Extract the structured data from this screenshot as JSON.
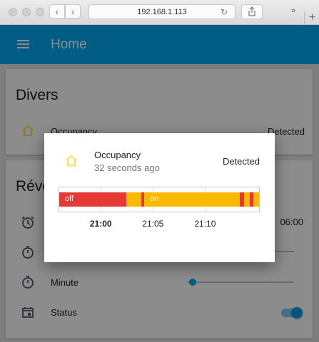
{
  "browser": {
    "address": "192.168.1.113",
    "back_glyph": "‹",
    "forward_glyph": "›",
    "reload_glyph": "↻",
    "more_glyph": "»",
    "newtab_glyph": "+"
  },
  "app": {
    "title": "Home",
    "accent": "#03a9f4"
  },
  "cards": {
    "divers": {
      "title": "Divers",
      "row_label": "Occupancy",
      "row_value": "Detected"
    },
    "reveil": {
      "title": "Réveil",
      "time_value": "06:00",
      "minute_label": "Minute",
      "status_label": "Status",
      "minute_level": 0.05,
      "status_on": true
    }
  },
  "dialog": {
    "entity_name": "Occupancy",
    "relative_time": "32 seconds ago",
    "state": "Detected",
    "icon": "home-icon",
    "icon_color": "#fdd835"
  },
  "chart_data": {
    "type": "timeline",
    "x_ticks": [
      "21:00",
      "21:05",
      "21:10"
    ],
    "colors": {
      "off": "#e53935",
      "on": "#fbb800",
      "marker": "#7e57c2"
    },
    "segments": [
      {
        "state": "off",
        "start": 0.0,
        "end": 0.335,
        "label": "off"
      },
      {
        "state": "on",
        "start": 0.335,
        "end": 0.41,
        "label": "."
      },
      {
        "state": "off",
        "start": 0.41,
        "end": 0.425,
        "label": ""
      },
      {
        "state": "on",
        "start": 0.425,
        "end": 0.905,
        "label": "on"
      },
      {
        "state": "off",
        "start": 0.905,
        "end": 0.925,
        "label": ""
      },
      {
        "state": "on",
        "start": 0.925,
        "end": 0.955,
        "label": ""
      },
      {
        "state": "off",
        "start": 0.955,
        "end": 0.97,
        "label": ""
      },
      {
        "state": "on",
        "start": 0.97,
        "end": 1.0,
        "label": ""
      }
    ],
    "tick_fractions": [
      0.208,
      0.469,
      0.73
    ]
  }
}
